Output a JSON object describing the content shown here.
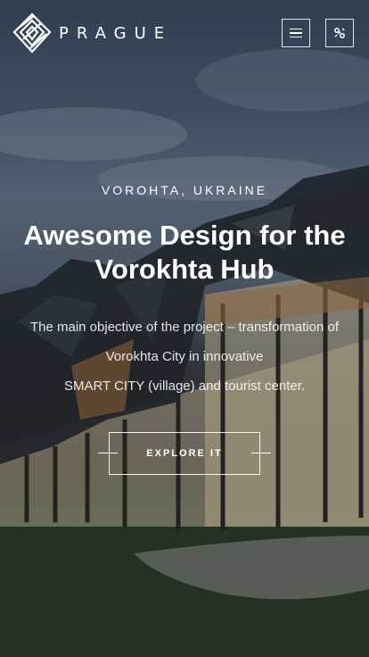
{
  "header": {
    "brand": "PRAGUE",
    "logo_icon": "layered-diamond-logo-icon",
    "menu_icon": "hamburger-menu-icon",
    "social_icon": "social-share-icon"
  },
  "hero": {
    "eyebrow": "VOROHTA, UKRAINE",
    "headline": "Awesome Design for the Vorokhta Hub",
    "description_line1": "The main objective of the project – transformation of",
    "description_line2": "Vorokhta City in innovative",
    "description_line3": "SMART CITY (village) and tourist center.",
    "cta_label": "EXPLORE IT"
  },
  "colors": {
    "text": "#ffffff",
    "sky": "#4e5f77",
    "grass": "#2c3a2a"
  }
}
